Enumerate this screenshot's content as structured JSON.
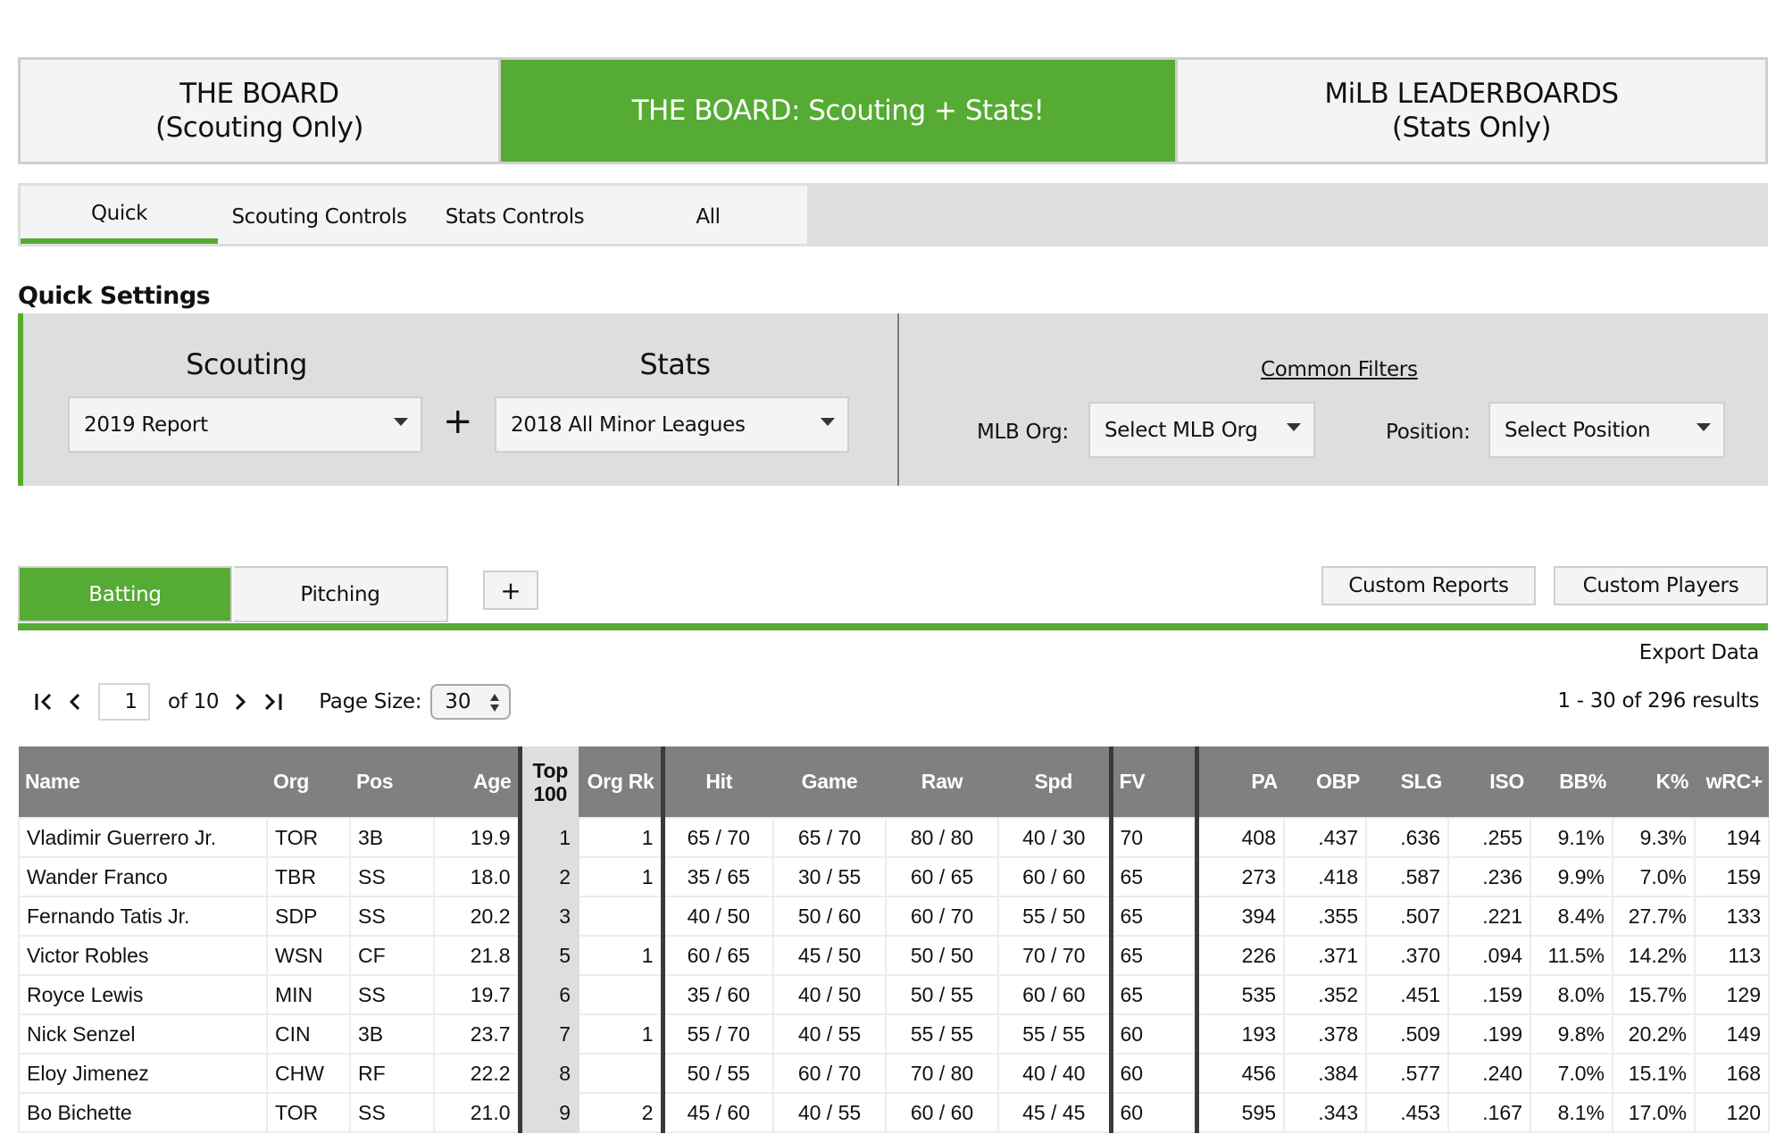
{
  "top_nav": {
    "tabs": [
      {
        "line1": "THE BOARD",
        "line2": "(Scouting Only)",
        "active": false
      },
      {
        "line1": "THE BOARD: Scouting + Stats!",
        "line2": "",
        "active": true
      },
      {
        "line1": "MiLB LEADERBOARDS",
        "line2": "(Stats Only)",
        "active": false
      }
    ]
  },
  "sub_tabs": {
    "items": [
      "Quick",
      "Scouting Controls",
      "Stats Controls",
      "All"
    ],
    "active": "Quick"
  },
  "quick_settings": {
    "title": "Quick Settings",
    "scouting_label": "Scouting",
    "scouting_value": "2019 Report",
    "plus": "+",
    "stats_label": "Stats",
    "stats_value": "2018 All Minor Leagues",
    "common_filters_label": "Common Filters",
    "mlb_org_label": "MLB Org:",
    "mlb_org_value": "Select MLB Org",
    "position_label": "Position:",
    "position_value": "Select Position"
  },
  "view_tabs": {
    "batting": "Batting",
    "pitching": "Pitching",
    "add": "+",
    "active": "Batting"
  },
  "actions": {
    "custom_reports": "Custom Reports",
    "custom_players": "Custom Players",
    "export": "Export Data"
  },
  "pagination": {
    "current_page": "1",
    "of_text": "of 10",
    "page_size_label": "Page Size:",
    "page_size": "30",
    "results_text": "1 - 30 of 296 results"
  },
  "colors": {
    "accent_green": "#55ab33",
    "header_gray": "#808080",
    "panel_gray": "#dedede"
  },
  "table": {
    "columns": [
      "Name",
      "Org",
      "Pos",
      "Age",
      "Top 100",
      "Org Rk",
      "Hit",
      "Game",
      "Raw",
      "Spd",
      "FV",
      "PA",
      "OBP",
      "SLG",
      "ISO",
      "BB%",
      "K%",
      "wRC+"
    ],
    "top100_line1": "Top",
    "top100_line2": "100",
    "rows": [
      [
        "Vladimir Guerrero Jr.",
        "TOR",
        "3B",
        "19.9",
        "1",
        "1",
        "65 / 70",
        "65 / 70",
        "80 / 80",
        "40 / 30",
        "70",
        "408",
        ".437",
        ".636",
        ".255",
        "9.1%",
        "9.3%",
        "194"
      ],
      [
        "Wander Franco",
        "TBR",
        "SS",
        "18.0",
        "2",
        "1",
        "35 / 65",
        "30 / 55",
        "60 / 65",
        "60 / 60",
        "65",
        "273",
        ".418",
        ".587",
        ".236",
        "9.9%",
        "7.0%",
        "159"
      ],
      [
        "Fernando Tatis Jr.",
        "SDP",
        "SS",
        "20.2",
        "3",
        "",
        "40 / 50",
        "50 / 60",
        "60 / 70",
        "55 / 50",
        "65",
        "394",
        ".355",
        ".507",
        ".221",
        "8.4%",
        "27.7%",
        "133"
      ],
      [
        "Victor Robles",
        "WSN",
        "CF",
        "21.8",
        "5",
        "1",
        "60 / 65",
        "45 / 50",
        "50 / 50",
        "70 / 70",
        "65",
        "226",
        ".371",
        ".370",
        ".094",
        "11.5%",
        "14.2%",
        "113"
      ],
      [
        "Royce Lewis",
        "MIN",
        "SS",
        "19.7",
        "6",
        "",
        "35 / 60",
        "40 / 50",
        "50 / 55",
        "60 / 60",
        "65",
        "535",
        ".352",
        ".451",
        ".159",
        "8.0%",
        "15.7%",
        "129"
      ],
      [
        "Nick Senzel",
        "CIN",
        "3B",
        "23.7",
        "7",
        "1",
        "55 / 70",
        "40 / 55",
        "55 / 55",
        "55 / 55",
        "60",
        "193",
        ".378",
        ".509",
        ".199",
        "9.8%",
        "20.2%",
        "149"
      ],
      [
        "Eloy Jimenez",
        "CHW",
        "RF",
        "22.2",
        "8",
        "",
        "50 / 55",
        "60 / 70",
        "70 / 80",
        "40 / 40",
        "60",
        "456",
        ".384",
        ".577",
        ".240",
        "7.0%",
        "15.1%",
        "168"
      ],
      [
        "Bo Bichette",
        "TOR",
        "SS",
        "21.0",
        "9",
        "2",
        "45 / 60",
        "40 / 55",
        "60 / 60",
        "45 / 45",
        "60",
        "595",
        ".343",
        ".453",
        ".167",
        "8.1%",
        "17.0%",
        "120"
      ]
    ]
  }
}
